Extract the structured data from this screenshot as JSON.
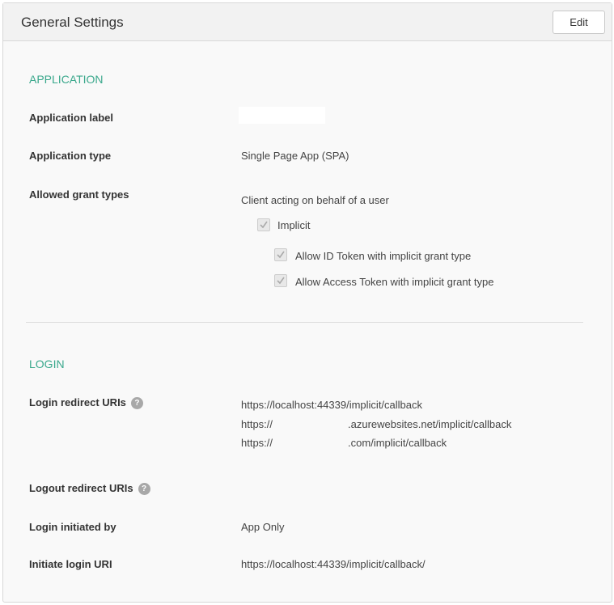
{
  "header": {
    "title": "General Settings",
    "edit_label": "Edit"
  },
  "application": {
    "section": "APPLICATION",
    "label_label": "Application label",
    "type_label": "Application type",
    "type_value": "Single Page App (SPA)",
    "grant_label": "Allowed grant types",
    "grant_intro": "Client acting on behalf of a user",
    "implicit": "Implicit",
    "allow_id": "Allow ID Token with implicit grant type",
    "allow_access": "Allow Access Token with implicit grant type"
  },
  "login": {
    "section": "LOGIN",
    "redirect_label": "Login redirect URIs",
    "help": "?",
    "redirects": [
      "https://localhost:44339/implicit/callback",
      "https://",
      ".azurewebsites.net/implicit/callback",
      "https://",
      ".com/implicit/callback"
    ],
    "logout_label": "Logout redirect URIs",
    "initiated_label": "Login initiated by",
    "initiated_value": "App Only",
    "initiate_uri_label": "Initiate login URI",
    "initiate_uri_value": "https://localhost:44339/implicit/callback/"
  }
}
